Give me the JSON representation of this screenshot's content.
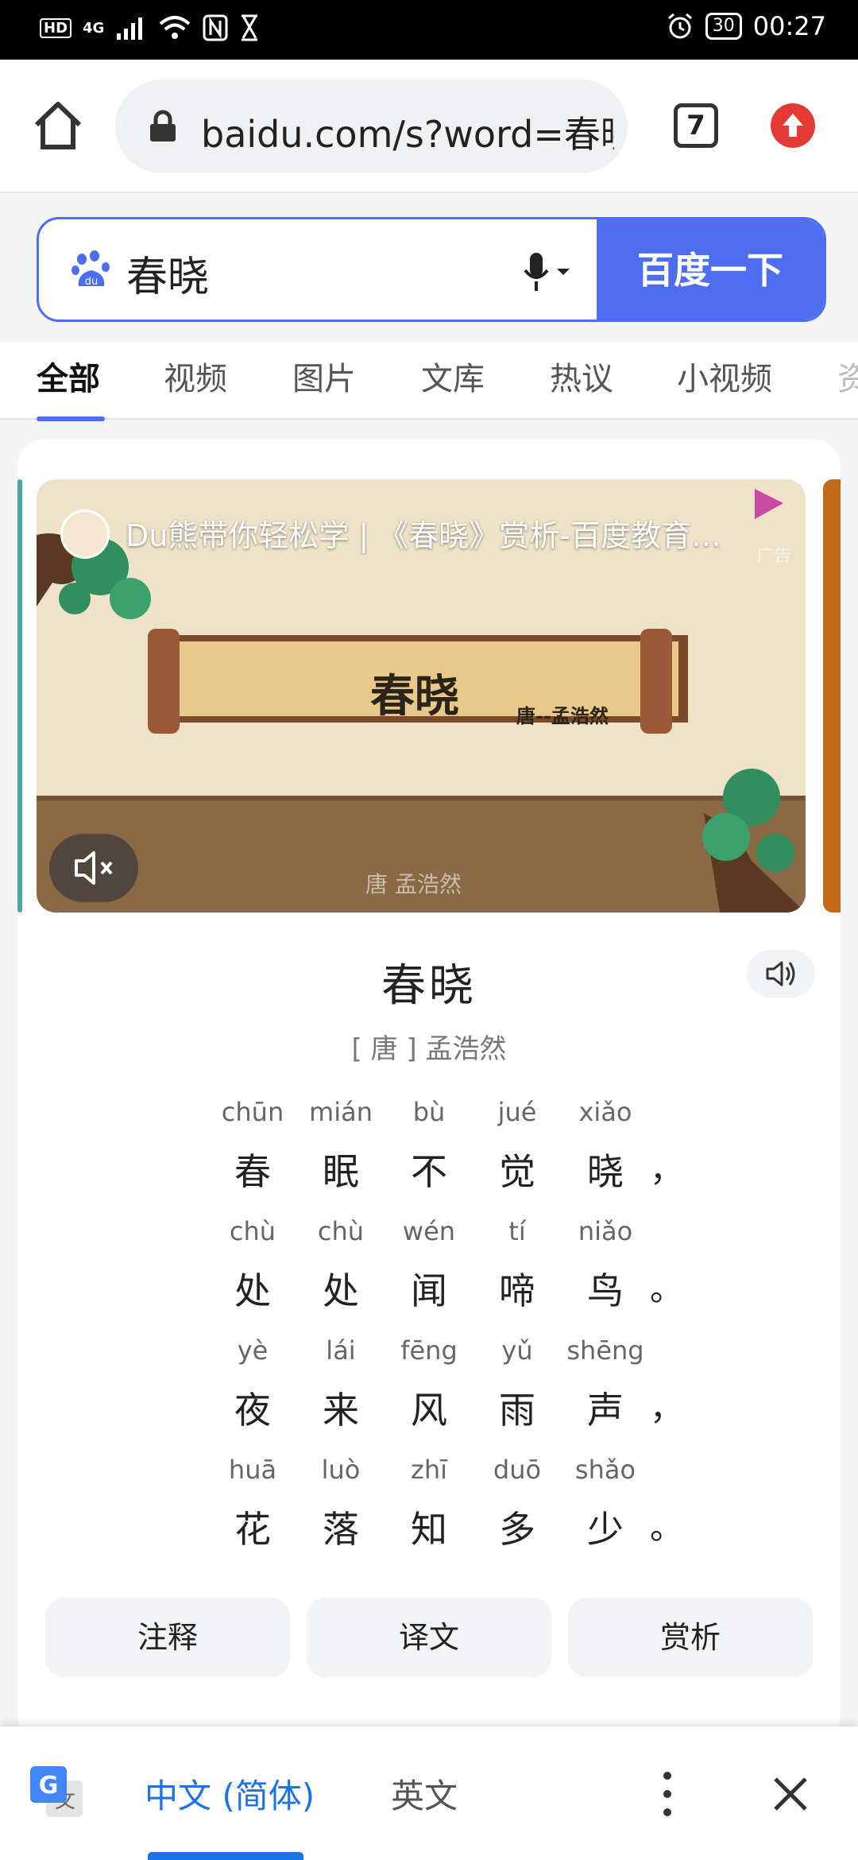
{
  "status_bar": {
    "left_indicators": [
      "HD",
      "4G"
    ],
    "battery": "30",
    "time": "00:27"
  },
  "browser": {
    "url": "baidu.com/s?word=春晓",
    "tab_count": "7",
    "icons": [
      "home-icon",
      "lock-icon",
      "tabs-icon",
      "update-icon"
    ]
  },
  "search": {
    "query": "春晓",
    "button_label": "百度一下"
  },
  "nav_tabs": [
    "全部",
    "视频",
    "图片",
    "文库",
    "热议",
    "小视频",
    "资"
  ],
  "video": {
    "title": "Du熊带你轻松学 | 《春晓》赏析-百度教育…",
    "ad_label": "广告",
    "scroll_title": "春晓",
    "scroll_author": "唐--孟浩然",
    "subtitle": "唐  孟浩然"
  },
  "poem": {
    "title": "春晓",
    "author": "[ 唐 ]  孟浩然",
    "lines": [
      {
        "pinyin": [
          "chūn",
          "mián",
          "bù",
          "jué",
          "xiǎo"
        ],
        "chars": [
          "春",
          "眠",
          "不",
          "觉",
          "晓"
        ],
        "punct": "，"
      },
      {
        "pinyin": [
          "chù",
          "chù",
          "wén",
          "tí",
          "niǎo"
        ],
        "chars": [
          "处",
          "处",
          "闻",
          "啼",
          "鸟"
        ],
        "punct": "。"
      },
      {
        "pinyin": [
          "yè",
          "lái",
          "fēng",
          "yǔ",
          "shēng"
        ],
        "chars": [
          "夜",
          "来",
          "风",
          "雨",
          "声"
        ],
        "punct": "，"
      },
      {
        "pinyin": [
          "huā",
          "luò",
          "zhī",
          "duō",
          "shǎo"
        ],
        "chars": [
          "花",
          "落",
          "知",
          "多",
          "少"
        ],
        "punct": "。"
      }
    ]
  },
  "actions": [
    "注释",
    "译文",
    "赏析"
  ],
  "translate_bar": {
    "source_lang": "中文 (简体)",
    "target_lang": "英文"
  },
  "colors": {
    "baidu_blue": "#4e6ef2",
    "google_blue": "#1a73e8",
    "update_red": "#e53935"
  }
}
